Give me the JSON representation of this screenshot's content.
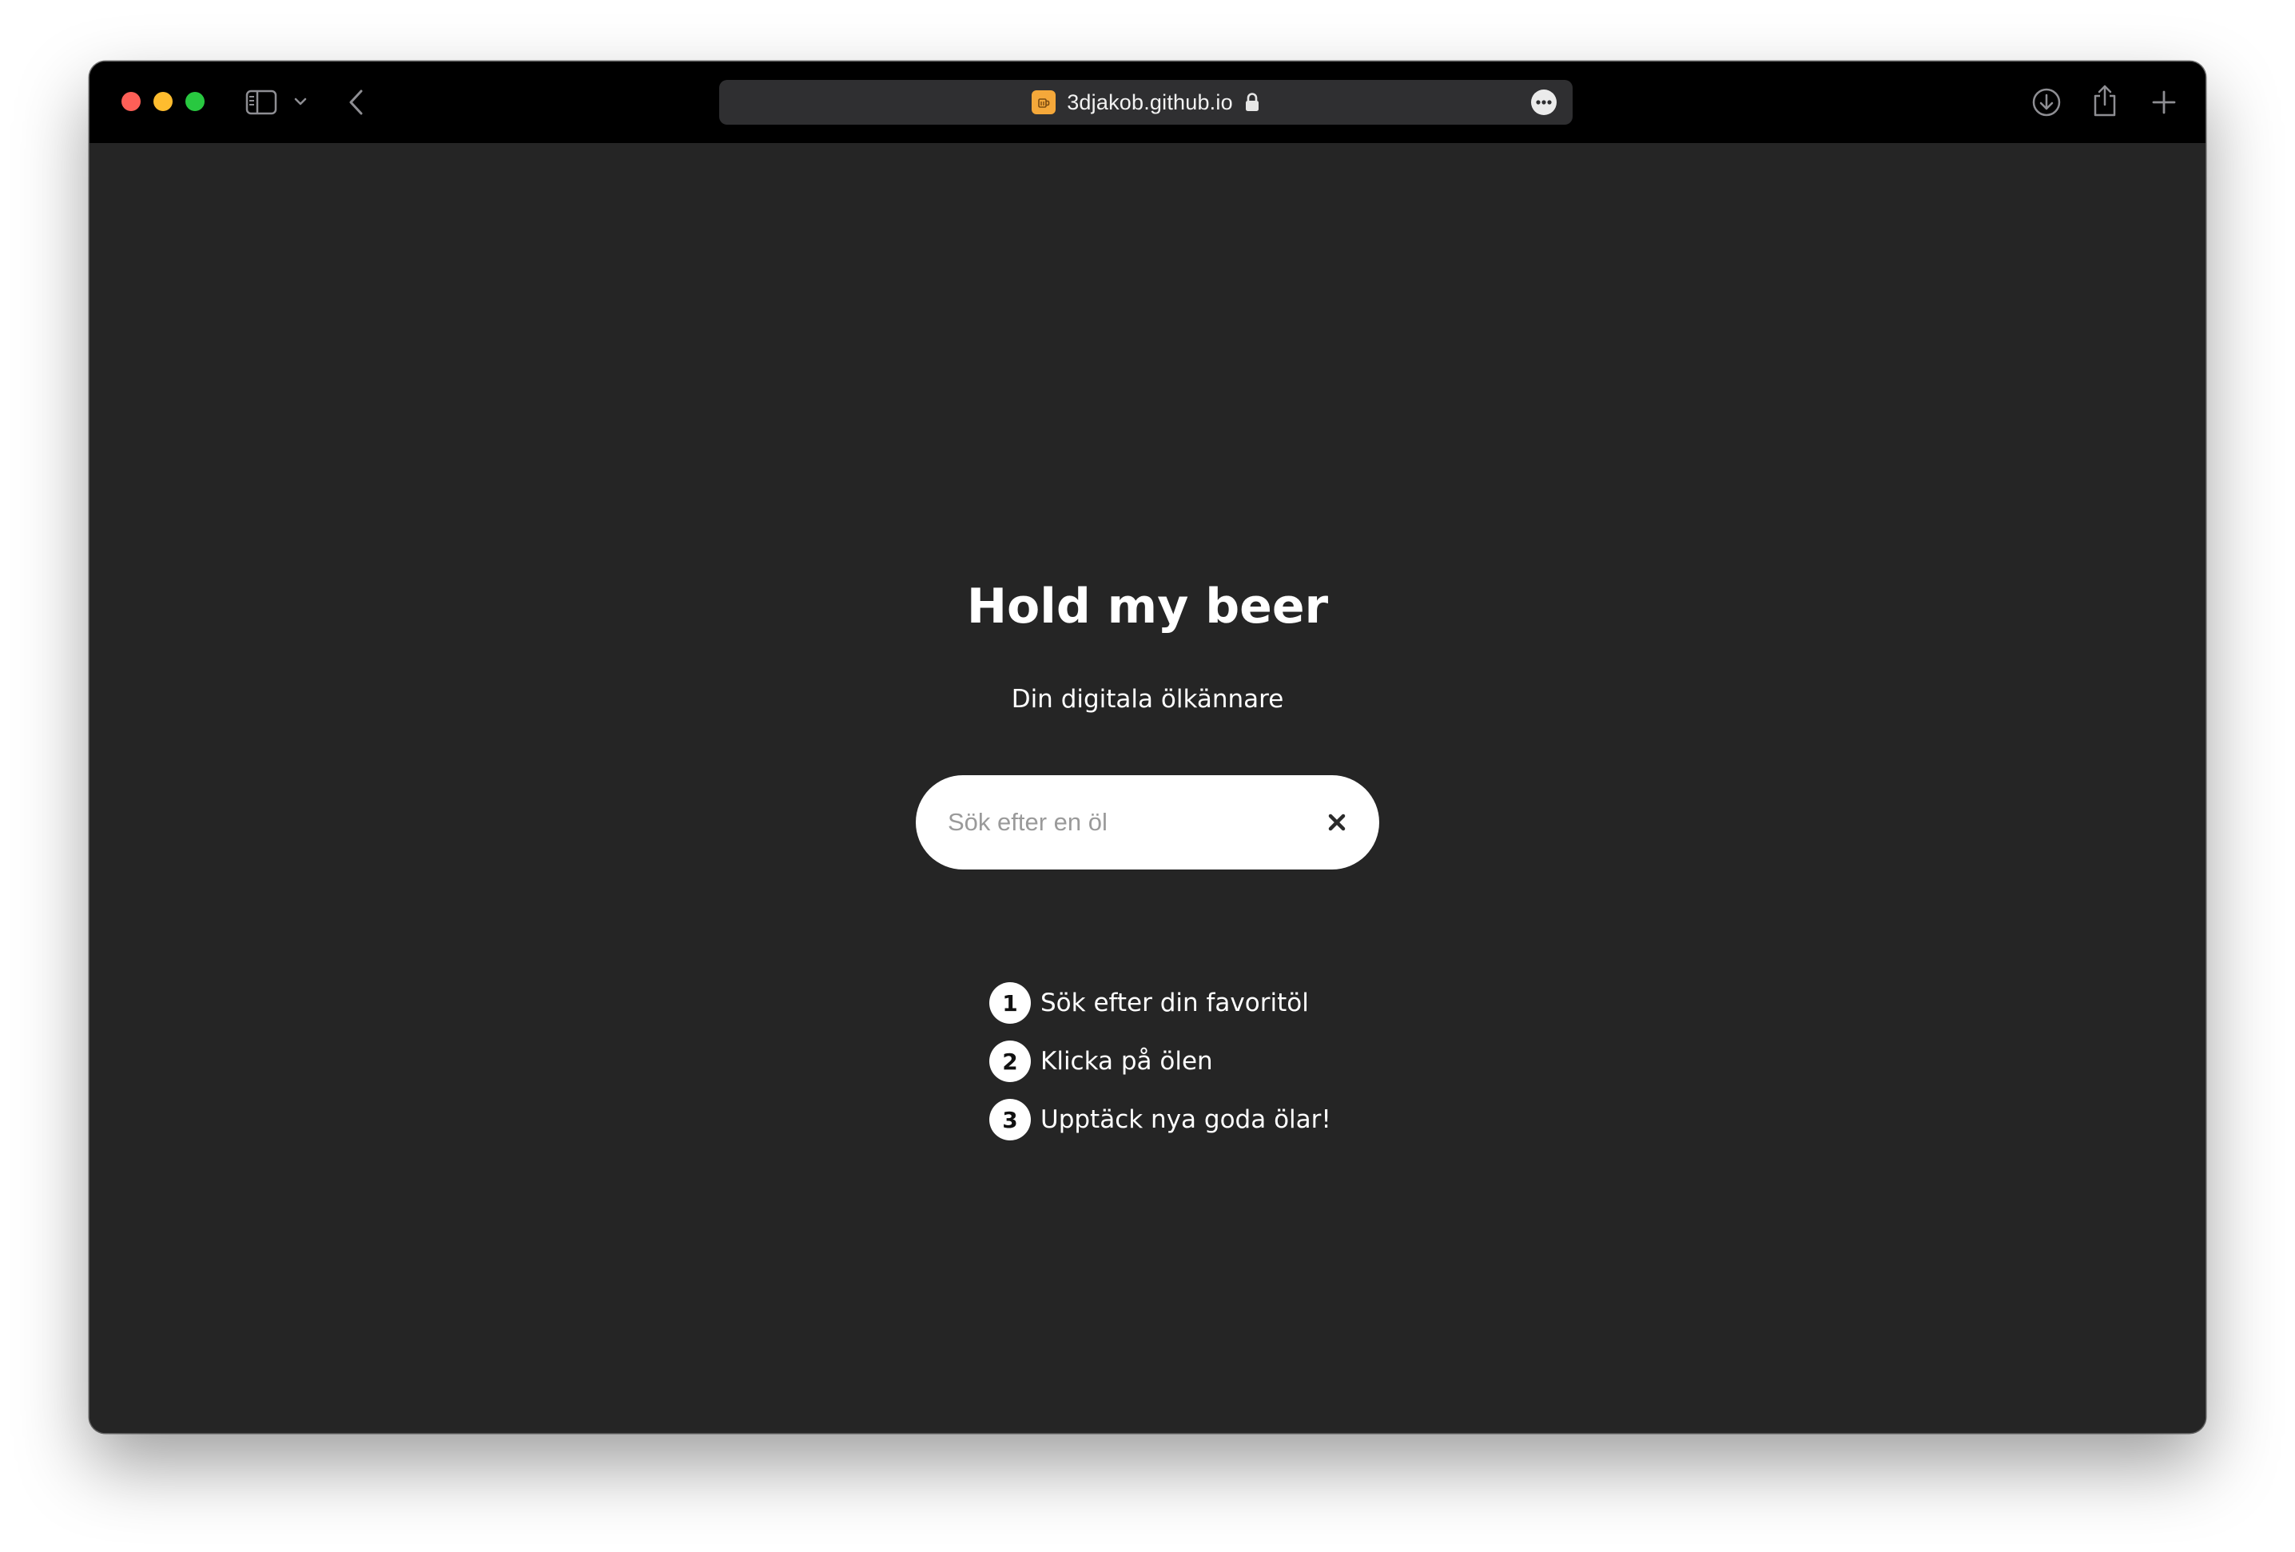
{
  "browser": {
    "url": "3djakob.github.io",
    "controls": {
      "close": "close-window",
      "minimize": "minimize-window",
      "zoom": "zoom-window"
    },
    "icons": [
      "sidebar-icon",
      "chevron-down-icon",
      "back-arrow-icon",
      "lock-icon",
      "more-icon",
      "download-icon",
      "share-icon",
      "plus-icon"
    ],
    "favicon_color": "#f5a83a"
  },
  "page": {
    "title": "Hold my beer",
    "subtitle": "Din digitala ölkännare",
    "search": {
      "placeholder": "Sök efter en öl",
      "value": ""
    },
    "steps": [
      {
        "number": "1",
        "text": "Sök efter din favoritöl"
      },
      {
        "number": "2",
        "text": "Klicka på ölen"
      },
      {
        "number": "3",
        "text": "Upptäck nya goda ölar!"
      }
    ]
  },
  "colors": {
    "background": "#252525",
    "titlebar": "#000000",
    "text": "#ffffff",
    "search_bg": "#ffffff",
    "placeholder": "#9a9a9a"
  }
}
